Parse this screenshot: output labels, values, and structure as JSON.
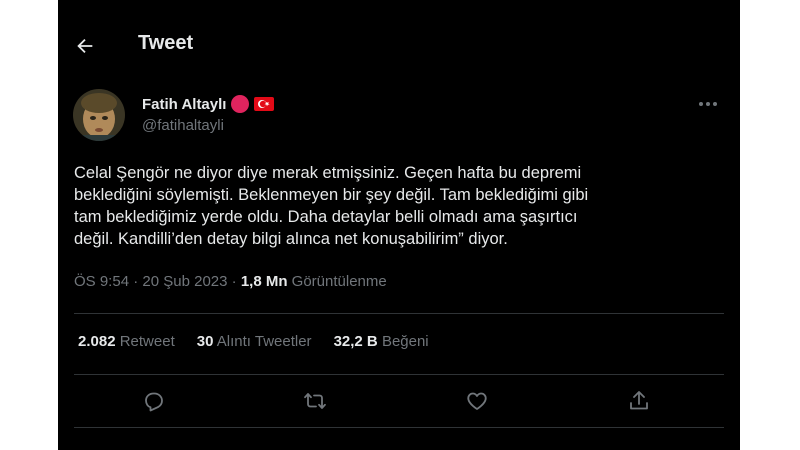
{
  "header": {
    "title": "Tweet"
  },
  "author": {
    "name": "Fatih Altaylı",
    "handle": "@fatihaltayli"
  },
  "tweet": {
    "text": "Celal Şengör ne diyor diye merak etmişsiniz. Geçen hafta bu depremi\nbeklediğini söylemişti. Beklenmeyen bir şey değil. Tam beklediğimi gibi\ntam beklediğimiz yerde oldu. Daha detaylar belli olmadı ama şaşırtıcı\ndeğil. Kandilli’den detay bilgi alınca net konuşabilirim” diyor.",
    "time": "ÖS 9:54",
    "sep1": "·",
    "date": "20 Şub 2023",
    "sep2": "·",
    "views": "1,8 Mn",
    "views_label": "Görüntülenme"
  },
  "stats": {
    "retweets": "2.082",
    "retweets_label": "Retweet",
    "quotes": "30",
    "quotes_label": "Alıntı Tweetler",
    "likes": "32,2 B",
    "likes_label": "Beğeni"
  },
  "icons": {
    "back": "arrow-left-icon",
    "more": "more-icon",
    "reply": "reply-icon",
    "retweet": "retweet-icon",
    "like": "heart-icon",
    "share": "share-icon"
  },
  "colors": {
    "background": "#000000",
    "text": "#e7e9ea",
    "muted": "#71767b",
    "divider": "#2f3336",
    "badge_red": "#e0245e"
  }
}
